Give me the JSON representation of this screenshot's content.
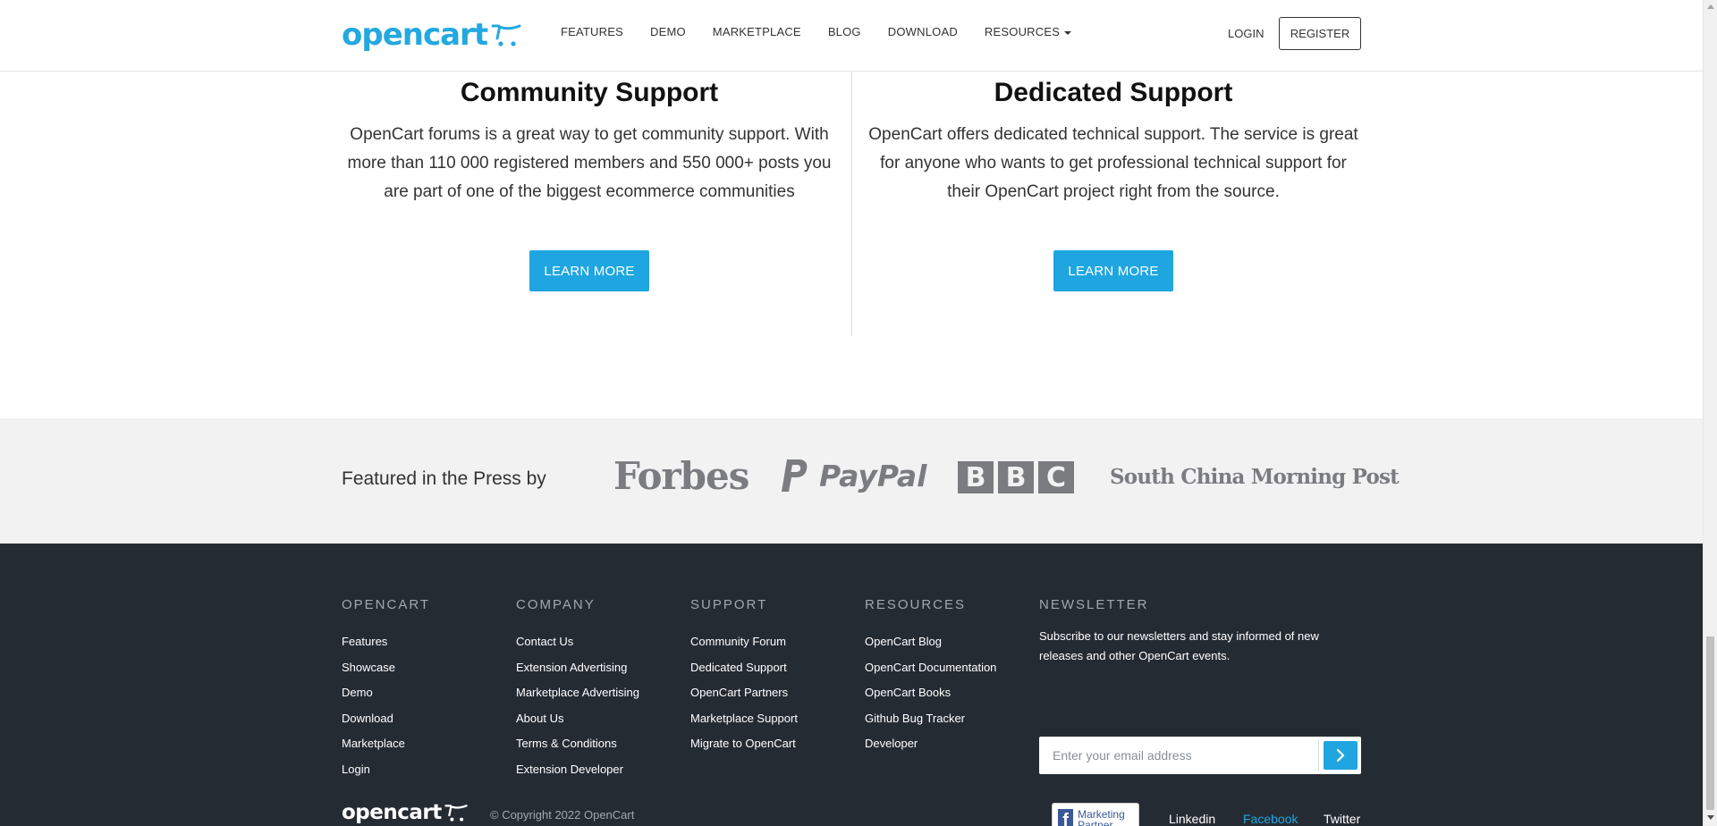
{
  "nav": {
    "logo_text": "opencart",
    "links": [
      "FEATURES",
      "DEMO",
      "MARKETPLACE",
      "BLOG",
      "DOWNLOAD",
      "RESOURCES"
    ],
    "login": "LOGIN",
    "register": "REGISTER"
  },
  "support": {
    "community": {
      "title": "Community Support",
      "text": "OpenCart forums is a great way to get community support. With more than 110 000 registered members and 550 000+ posts you are part of one of the biggest ecommerce communities",
      "button": "LEARN MORE"
    },
    "dedicated": {
      "title": "Dedicated Support",
      "text": "OpenCart offers dedicated technical support. The service is great for anyone who wants to get professional technical support for their OpenCart project right from the source.",
      "button": "LEARN MORE"
    }
  },
  "press": {
    "label": "Featured in the Press by",
    "logos": [
      "Forbes",
      "PayPal",
      "BBC",
      "South China Morning Post"
    ]
  },
  "footer": {
    "columns": [
      {
        "heading": "OPENCART",
        "items": [
          "Features",
          "Showcase",
          "Demo",
          "Download",
          "Marketplace",
          "Login"
        ]
      },
      {
        "heading": "COMPANY",
        "items": [
          "Contact Us",
          "Extension Advertising",
          "Marketplace Advertising",
          "About Us",
          "Terms & Conditions",
          "Extension Developer"
        ]
      },
      {
        "heading": "SUPPORT",
        "items": [
          "Community Forum",
          "Dedicated Support",
          "OpenCart Partners",
          "Marketplace Support",
          "Migrate to OpenCart"
        ]
      },
      {
        "heading": "RESOURCES",
        "items": [
          "OpenCart Blog",
          "OpenCart Documentation",
          "OpenCart Books",
          "Github Bug Tracker",
          "Developer"
        ]
      }
    ],
    "newsletter": {
      "heading": "NEWSLETTER",
      "text": "Subscribe to our newsletters and stay informed of new releases and other OpenCart events.",
      "placeholder": "Enter your email address"
    },
    "logo_text": "opencart",
    "copyright": "© Copyright 2022 OpenCart",
    "fb_badge": "Marketing Partner",
    "social": [
      "Linkedin",
      "Facebook",
      "Twitter"
    ]
  },
  "colors": {
    "accent": "#1fa6e0",
    "footer_bg": "#252b33",
    "press_bg": "#f2f2f2"
  }
}
